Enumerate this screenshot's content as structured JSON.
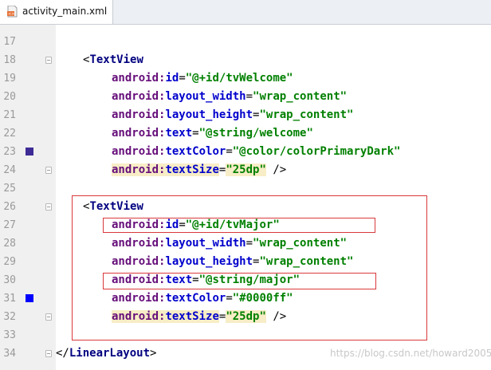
{
  "tab": {
    "label": "activity_main.xml",
    "icon": "xml-file-icon"
  },
  "lines": [
    {
      "num": "17"
    },
    {
      "num": "18",
      "open": "<",
      "tag": "TextView"
    },
    {
      "num": "19",
      "ns": "android",
      "attr": "id",
      "eq": "=",
      "value": "\"@+id/tvWelcome\""
    },
    {
      "num": "20",
      "ns": "android",
      "attr": "layout_width",
      "eq": "=",
      "value": "\"wrap_content\""
    },
    {
      "num": "21",
      "ns": "android",
      "attr": "layout_height",
      "eq": "=",
      "value": "\"wrap_content\""
    },
    {
      "num": "22",
      "ns": "android",
      "attr": "text",
      "eq": "=",
      "value": "\"@string/welcome\""
    },
    {
      "num": "23",
      "ns": "android",
      "attr": "textColor",
      "eq": "=",
      "value": "\"@color/colorPrimaryDark\"",
      "swatch": "#3f2b96"
    },
    {
      "num": "24",
      "ns": "android",
      "attr": "textSize",
      "eq": "=",
      "value": "\"25dp\"",
      "close": " />"
    },
    {
      "num": "25"
    },
    {
      "num": "26",
      "open": "<",
      "tag": "TextView"
    },
    {
      "num": "27",
      "ns": "android",
      "attr": "id",
      "eq": "=",
      "value": "\"@+id/tvMajor\""
    },
    {
      "num": "28",
      "ns": "android",
      "attr": "layout_width",
      "eq": "=",
      "value": "\"wrap_content\""
    },
    {
      "num": "29",
      "ns": "android",
      "attr": "layout_height",
      "eq": "=",
      "value": "\"wrap_content\""
    },
    {
      "num": "30",
      "ns": "android",
      "attr": "text",
      "eq": "=",
      "value": "\"@string/major\""
    },
    {
      "num": "31",
      "ns": "android",
      "attr": "textColor",
      "eq": "=",
      "value": "\"#0000ff\"",
      "swatch": "#0000ff"
    },
    {
      "num": "32",
      "ns": "android",
      "attr": "textSize",
      "eq": "=",
      "value": "\"25dp\"",
      "close": " />"
    },
    {
      "num": "33"
    },
    {
      "num": "34",
      "open": "</",
      "tag": "LinearLayout",
      "close": ">"
    }
  ],
  "watermark": "https://blog.csdn.net/howard2005",
  "colors": {
    "highlight_box": "#d9393b",
    "tag": "#000080",
    "attribute": "#0000cc",
    "namespace": "#660e7a",
    "string": "#008000"
  }
}
